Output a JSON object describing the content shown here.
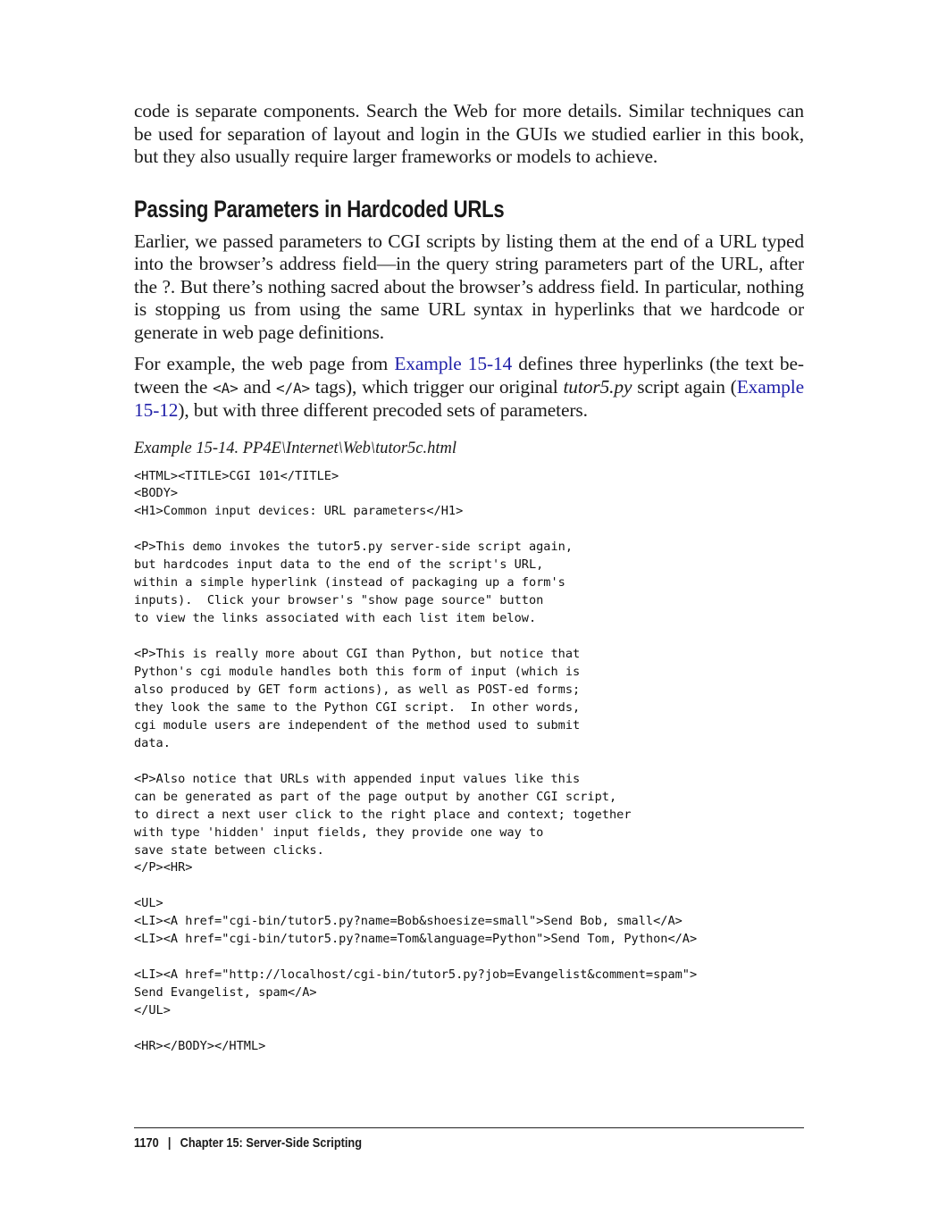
{
  "intro_paragraph": "code is separate components. Search the Web for more details. Similar techniques can be used for separation of layout and login in the GUIs we studied earlier in this book, but they also usually require larger frameworks or models to achieve.",
  "section_heading": "Passing Parameters in Hardcoded URLs",
  "paragraph1": "Earlier, we passed parameters to CGI scripts by listing them at the end of a URL typed into the browser’s address field—in the query string parameters part of the URL, after the ?. But there’s nothing sacred about the browser’s address field. In particular, noth­ing is stopping us from using the same URL syntax in hyperlinks that we hardcode or generate in web page definitions.",
  "paragraph2": {
    "part1": "For example, the web page from ",
    "link1": "Example 15-14",
    "part2": " defines three hyperlinks (the text be­tween the ",
    "code1": "<A>",
    "part3": " and ",
    "code2": "</A>",
    "part4": " tags), which trigger our original ",
    "emph": "tutor5.py",
    "part5": " script again (",
    "link2": "Exam­ple 15-12",
    "part6": "), but with three different precoded sets of parameters."
  },
  "example_caption": "Example 15-14. PP4E\\Internet\\Web\\tutor5c.html",
  "code_listing": "<HTML><TITLE>CGI 101</TITLE>\n<BODY>\n<H1>Common input devices: URL parameters</H1>\n\n<P>This demo invokes the tutor5.py server-side script again,\nbut hardcodes input data to the end of the script's URL,\nwithin a simple hyperlink (instead of packaging up a form's\ninputs).  Click your browser's \"show page source\" button\nto view the links associated with each list item below.\n\n<P>This is really more about CGI than Python, but notice that\nPython's cgi module handles both this form of input (which is\nalso produced by GET form actions), as well as POST-ed forms;\nthey look the same to the Python CGI script.  In other words,\ncgi module users are independent of the method used to submit\ndata.\n\n<P>Also notice that URLs with appended input values like this\ncan be generated as part of the page output by another CGI script,\nto direct a next user click to the right place and context; together\nwith type 'hidden' input fields, they provide one way to\nsave state between clicks.\n</P><HR>\n\n<UL>\n<LI><A href=\"cgi-bin/tutor5.py?name=Bob&shoesize=small\">Send Bob, small</A>\n<LI><A href=\"cgi-bin/tutor5.py?name=Tom&language=Python\">Send Tom, Python</A>\n\n<LI><A href=\"http://localhost/cgi-bin/tutor5.py?job=Evangelist&comment=spam\">\nSend Evangelist, spam</A>\n</UL>\n\n<HR></BODY></HTML>",
  "footer": {
    "page_number": "1170",
    "separator": "|",
    "chapter": "Chapter 15:  Server-Side Scripting"
  }
}
